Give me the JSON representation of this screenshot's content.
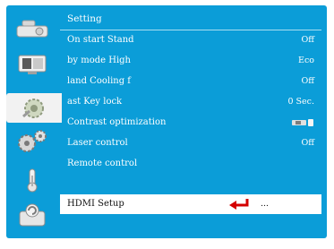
{
  "sidebar": {
    "items": [
      {
        "icon": "projector-icon"
      },
      {
        "icon": "screen-display-icon"
      },
      {
        "icon": "gear-setting-icon",
        "active": true
      },
      {
        "icon": "options-gears-icon"
      },
      {
        "icon": "thermometer-icon"
      },
      {
        "icon": "info-reset-icon"
      }
    ]
  },
  "menu": {
    "title": "Setting",
    "rows": [
      {
        "label": "On start  Stand",
        "value": "Off"
      },
      {
        "label": "by mode  High",
        "value": "Eco"
      },
      {
        "label": "land  Cooling f",
        "value": "Off"
      },
      {
        "label": "ast  Key lock",
        "value": "0 Sec."
      },
      {
        "label": "Contrast optimization",
        "value": ""
      },
      {
        "label": "Laser control",
        "value": "Off"
      },
      {
        "label": "Remote control",
        "value": ""
      }
    ],
    "selected_row": {
      "label": "HDMI Setup",
      "value": "..."
    }
  },
  "colors": {
    "background": "#0b9dd8",
    "selection": "#ffffff",
    "accent_arrow": "#d40000"
  }
}
